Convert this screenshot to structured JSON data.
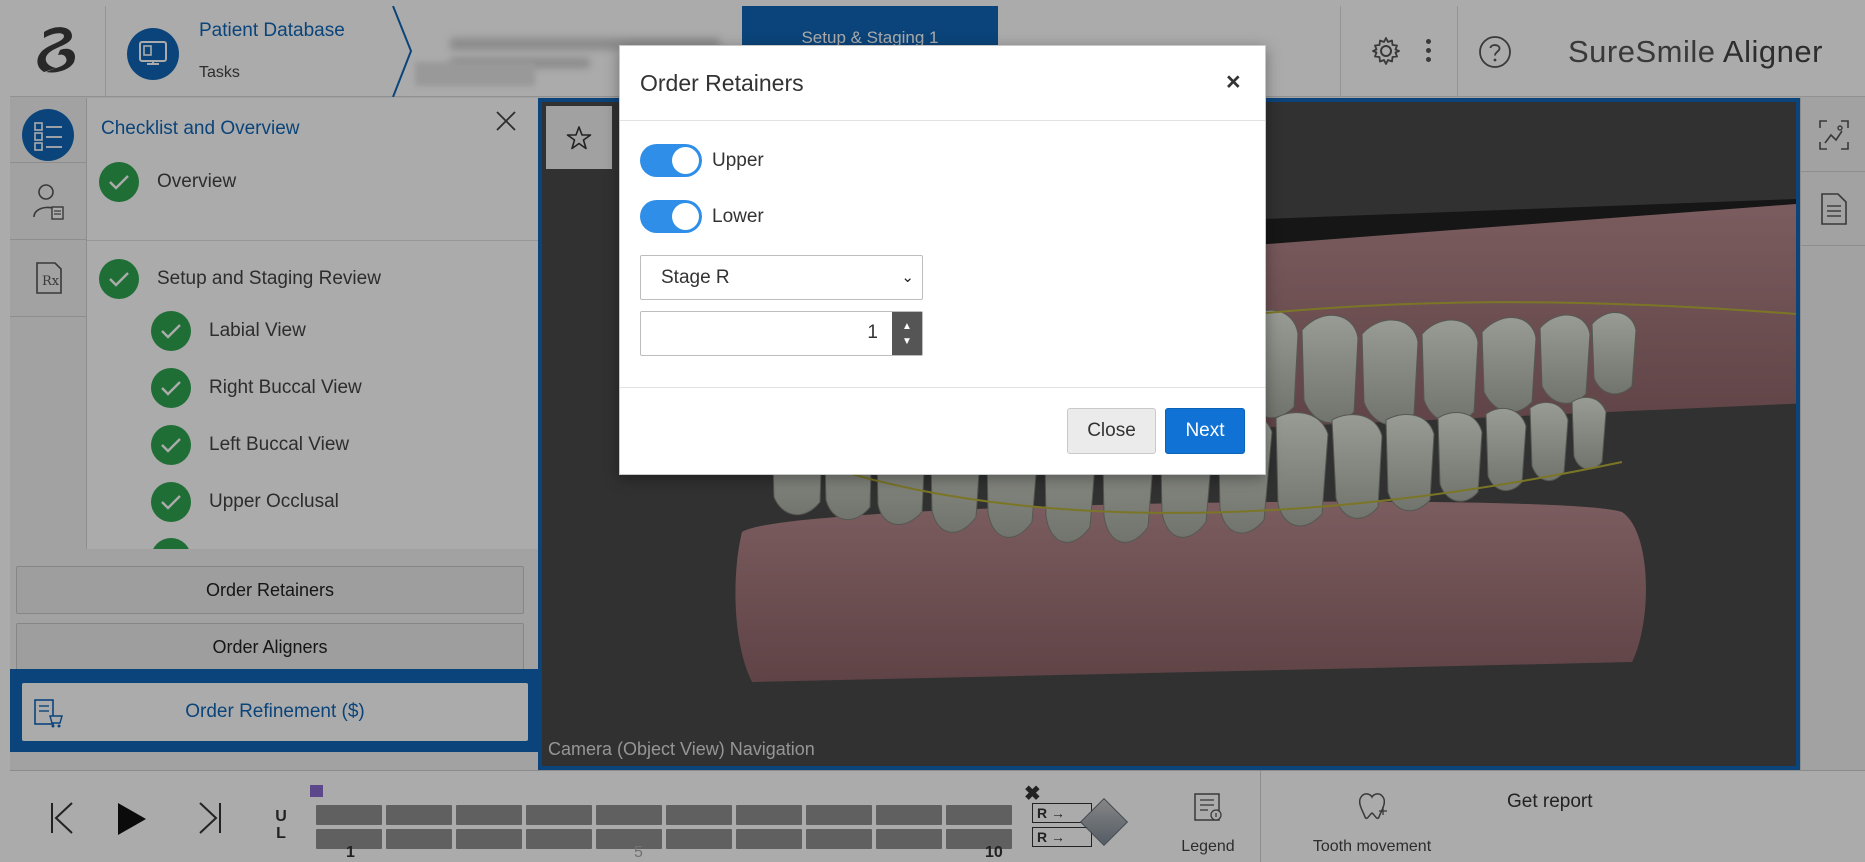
{
  "header": {
    "db_title": "Patient Database",
    "db_subtitle": "Tasks",
    "active_tab": "Setup & Staging 1",
    "brand_suresmile": "SureSmile",
    "brand_aligner": "Aligner"
  },
  "checklist": {
    "title": "Checklist and Overview",
    "items": [
      {
        "label": "Overview"
      },
      {
        "label": "Setup and Staging Review"
      },
      {
        "label": "Labial View"
      },
      {
        "label": "Right Buccal View"
      },
      {
        "label": "Left Buccal View"
      },
      {
        "label": "Upper Occlusal"
      }
    ]
  },
  "actions": {
    "order_retainers": "Order Retainers",
    "order_aligners": "Order Aligners",
    "order_refinement": "Order Refinement ($)"
  },
  "viewer": {
    "camera_label": "Camera (Object View) Navigation"
  },
  "timeline": {
    "upper_label": "U",
    "lower_label": "L",
    "stage_numbers": [
      "1",
      "5",
      "10"
    ],
    "r_label_upper": "R →",
    "r_label_lower": "R →",
    "legend_label": "Legend",
    "tooth_movement_label": "Tooth movement",
    "get_report_label": "Get report"
  },
  "modal": {
    "title": "Order Retainers",
    "upper_label": "Upper",
    "upper_on": true,
    "lower_label": "Lower",
    "lower_on": true,
    "stage_select_value": "Stage R",
    "quantity_value": "1",
    "close_label": "Close",
    "next_label": "Next"
  },
  "colors": {
    "primary_blue": "#1166b6",
    "success_green": "#2ea44f",
    "toggle_blue": "#2f8ee8",
    "next_blue": "#0f72d4"
  }
}
